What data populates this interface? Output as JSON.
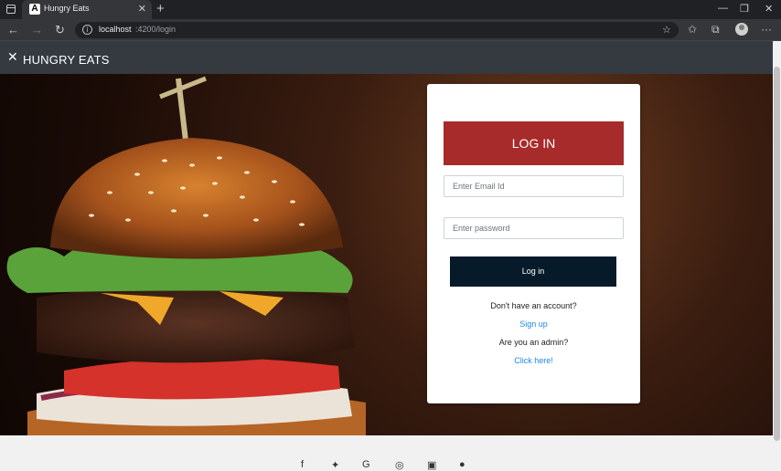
{
  "browser": {
    "tab_favicon": "A",
    "tab_title": "Hungry Eats",
    "tab_close": "✕",
    "new_tab": "+",
    "url_host": "localhost",
    "url_path": ":4200/login",
    "window_controls": [
      "—",
      "❐",
      "✕"
    ]
  },
  "navbar": {
    "brand": "HUNGRY EATS",
    "brand_icon": "fork-knife-icon"
  },
  "login": {
    "title": "LOG IN",
    "email_placeholder": "Enter Email Id",
    "password_placeholder": "Enter password",
    "login_button": "Log in",
    "no_account_text": "Don't have an account?",
    "signup_link": "Sign up",
    "admin_text": "Are you an admin?",
    "admin_link": "Click here!"
  },
  "footer": {
    "icons": [
      "facebook-icon",
      "twitter-icon",
      "google-icon",
      "instagram-icon",
      "linkedin-icon",
      "github-icon"
    ]
  },
  "colors": {
    "navbar": "#343a40",
    "login_header": "#a72b2a",
    "login_button": "#061a2a",
    "link": "#1e88e5"
  }
}
